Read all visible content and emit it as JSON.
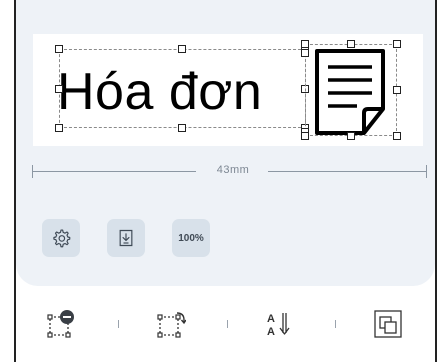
{
  "canvas": {
    "label_text": "Hóa đơn",
    "width_label": "43mm",
    "element_icon": "document-icon"
  },
  "tools": {
    "settings_icon": "gear-icon",
    "import_icon": "import-icon",
    "zoom_label": "100%"
  },
  "bottom_toolbar": {
    "items": [
      {
        "icon": "remove-element-icon"
      },
      {
        "icon": "rotate-icon"
      },
      {
        "icon": "sort-alpha-icon"
      },
      {
        "icon": "layers-icon"
      }
    ]
  },
  "colors": {
    "panel_bg": "#eef2f7",
    "button_bg": "#d8e1ea"
  }
}
